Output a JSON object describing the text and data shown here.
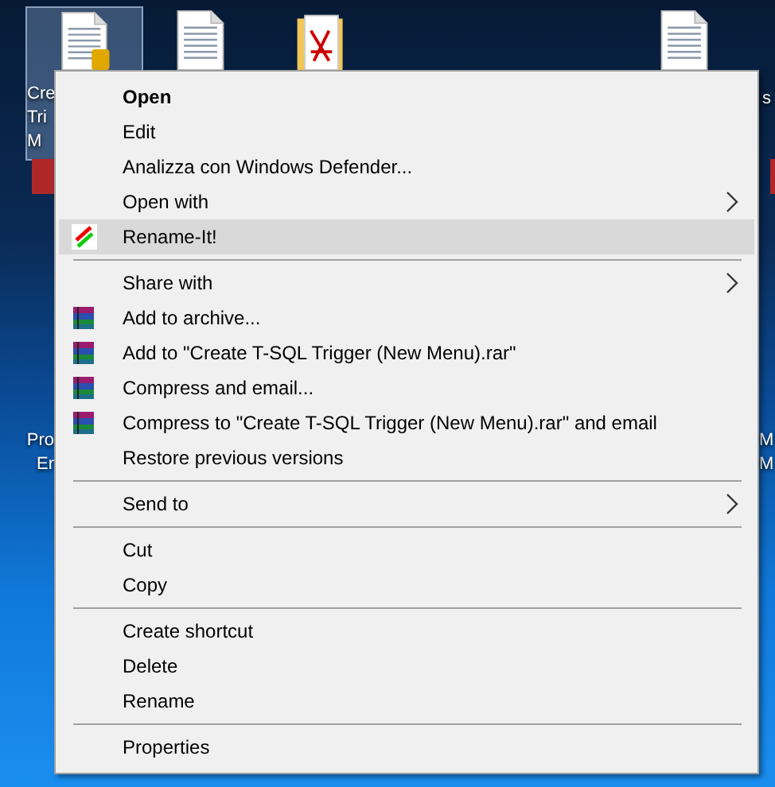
{
  "desktop_icons": [
    {
      "kind": "database-document",
      "selected": true,
      "label_lines": [
        "Cre",
        "Tri",
        "M"
      ]
    },
    {
      "kind": "document",
      "selected": false
    },
    {
      "kind": "pdf-folder",
      "selected": false
    },
    {
      "kind": "document",
      "selected": false,
      "label_lines": [
        "s"
      ]
    },
    {
      "kind": "app",
      "selected": false,
      "label_lines": [
        "Pro",
        "Er"
      ]
    },
    {
      "kind": "app",
      "selected": false,
      "label_lines": [
        "M",
        "M"
      ]
    }
  ],
  "context_menu": {
    "items": [
      {
        "kind": "plain",
        "label": "Open",
        "bold": true,
        "submenu": false,
        "selected": false
      },
      {
        "kind": "plain",
        "label": "Edit",
        "bold": false,
        "submenu": false,
        "selected": false
      },
      {
        "kind": "plain",
        "label": "Analizza con Windows Defender...",
        "bold": false,
        "submenu": false,
        "selected": false
      },
      {
        "kind": "plain",
        "label": "Open with",
        "bold": false,
        "submenu": true,
        "selected": false
      },
      {
        "kind": "rename",
        "label": "Rename-It!",
        "bold": false,
        "submenu": false,
        "selected": true
      },
      {
        "kind": "separator"
      },
      {
        "kind": "plain",
        "label": "Share with",
        "bold": false,
        "submenu": true,
        "selected": false
      },
      {
        "kind": "archive",
        "label": "Add to archive...",
        "bold": false,
        "submenu": false,
        "selected": false
      },
      {
        "kind": "archive",
        "label": "Add to \"Create T-SQL Trigger (New Menu).rar\"",
        "bold": false,
        "submenu": false,
        "selected": false
      },
      {
        "kind": "archive",
        "label": "Compress and email...",
        "bold": false,
        "submenu": false,
        "selected": false
      },
      {
        "kind": "archive",
        "label": "Compress to \"Create T-SQL Trigger (New Menu).rar\" and email",
        "bold": false,
        "submenu": false,
        "selected": false
      },
      {
        "kind": "plain",
        "label": "Restore previous versions",
        "bold": false,
        "submenu": false,
        "selected": false
      },
      {
        "kind": "separator"
      },
      {
        "kind": "plain",
        "label": "Send to",
        "bold": false,
        "submenu": true,
        "selected": false
      },
      {
        "kind": "separator"
      },
      {
        "kind": "plain",
        "label": "Cut",
        "bold": false,
        "submenu": false,
        "selected": false
      },
      {
        "kind": "plain",
        "label": "Copy",
        "bold": false,
        "submenu": false,
        "selected": false
      },
      {
        "kind": "separator"
      },
      {
        "kind": "plain",
        "label": "Create shortcut",
        "bold": false,
        "submenu": false,
        "selected": false
      },
      {
        "kind": "plain",
        "label": "Delete",
        "bold": false,
        "submenu": false,
        "selected": false
      },
      {
        "kind": "plain",
        "label": "Rename",
        "bold": false,
        "submenu": false,
        "selected": false
      },
      {
        "kind": "separator"
      },
      {
        "kind": "plain",
        "label": "Properties",
        "bold": false,
        "submenu": false,
        "selected": false
      }
    ]
  }
}
